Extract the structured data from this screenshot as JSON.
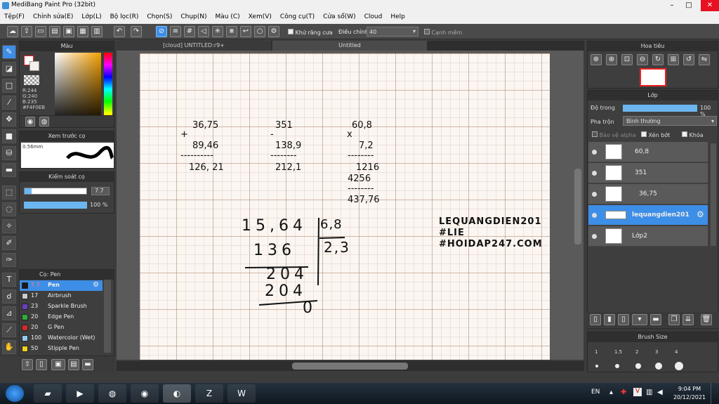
{
  "window": {
    "title": "MediBang Paint Pro (32bit)",
    "min": "–",
    "max": "□",
    "close": "✕"
  },
  "menu": [
    "Tệp(F)",
    "Chỉnh sửa(E)",
    "Lớp(L)",
    "Bộ lọc(R)",
    "Chọn(S)",
    "Chụp(N)",
    "Màu (C)",
    "Xem(V)",
    "Công cụ(T)",
    "Cửa sổ(W)",
    "Cloud",
    "Help"
  ],
  "toolbar": {
    "antialias": "Khử răng cưa",
    "adjust": "Điều chỉnh",
    "adjust_value": "40",
    "sharp": "Cạnh mềm"
  },
  "tabs": [
    "[cloud] UNTITLED:r9+",
    "Untitled"
  ],
  "color_panel": {
    "title": "Màu",
    "r": "R:244",
    "g": "G:240",
    "b": "B:235",
    "hex": "#F4F0EB"
  },
  "preview_panel": {
    "title": "Xem trước cọ",
    "size": "0.56mm"
  },
  "brush_control": {
    "title": "Kiểm soát cọ",
    "size": "7.7",
    "opacity": "100 %"
  },
  "brush_panel": {
    "title": "Cọ: Pen",
    "items": [
      {
        "value": "7.7",
        "name": "Pen",
        "color": "#1a1a1a"
      },
      {
        "value": "17",
        "name": "Airbrush",
        "color": "#cccccc"
      },
      {
        "value": "23",
        "name": "Sparkle Brush",
        "color": "#6a3fbf"
      },
      {
        "value": "20",
        "name": "Edge Pen",
        "color": "#2fae3a"
      },
      {
        "value": "20",
        "name": "G Pen",
        "color": "#d62a2a"
      },
      {
        "value": "100",
        "name": "Watercolor (Wet)",
        "color": "#8fcbf0"
      },
      {
        "value": "50",
        "name": "Stipple Pen",
        "color": "#f0d020"
      }
    ]
  },
  "navigator": {
    "title": "Hoa tiêu"
  },
  "layer_panel": {
    "title": "Lớp",
    "opacity_label": "Độ trong",
    "opacity_value": "100 %",
    "blend_label": "Pha trộn",
    "blend_value": "Bình thường",
    "protect": "Bảo vệ alpha",
    "clip": "Xén bớt",
    "lock": "Khóa",
    "layers": [
      "60,8",
      "351",
      "36,75",
      "lequangdien201",
      "Lớp2"
    ]
  },
  "brush_size": {
    "title": "Brush Size",
    "sizes": [
      "1",
      "1.5",
      "2",
      "3",
      "4"
    ]
  },
  "canvas_text": {
    "a1": "36,75",
    "a_op": "+",
    "a2": "89,46",
    "a_line": "----------",
    "a_res": "126, 21",
    "b1": "351",
    "b_op": "-",
    "b2": "138,9",
    "b_line": "--------",
    "b_res": "212,1",
    "c1": "60,8",
    "c_op": "x",
    "c2": "7,2",
    "c_line": "--------",
    "c_r1": "1216",
    "c_r2": "4256",
    "c_line2": "--------",
    "c_res": "437,76",
    "d_dividend": "15,64",
    "d_divisor": "6,8",
    "d_q": "2,3",
    "d_s1": "136",
    "d_r1": "204",
    "d_s2": "204",
    "d_r2": "0",
    "wm1": "LEQUANGDIEN201",
    "wm2": "#LIE",
    "wm3": "#HOIDAP247.COM"
  },
  "taskbar": {
    "lang": "EN",
    "time": "9:04 PM",
    "date": "20/12/2021",
    "apps": [
      "explorer",
      "media",
      "chrome-alt",
      "chrome",
      "paint",
      "zalo",
      "word"
    ]
  }
}
